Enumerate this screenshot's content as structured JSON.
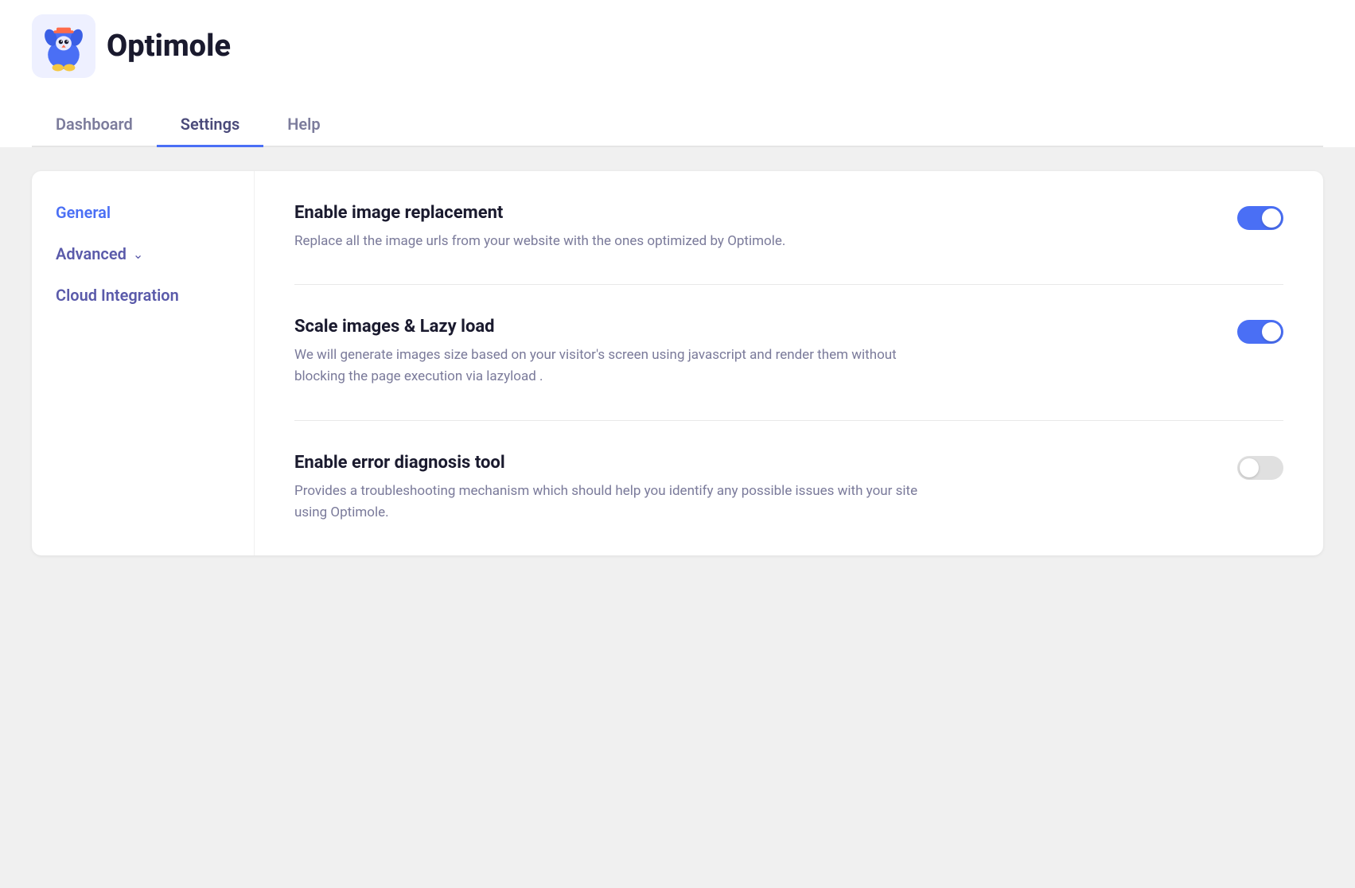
{
  "header": {
    "logo_text": "Optimole",
    "tabs": [
      {
        "id": "dashboard",
        "label": "Dashboard",
        "active": false
      },
      {
        "id": "settings",
        "label": "Settings",
        "active": true
      },
      {
        "id": "help",
        "label": "Help",
        "active": false
      }
    ]
  },
  "sidebar": {
    "items": [
      {
        "id": "general",
        "label": "General",
        "active": true,
        "has_chevron": false
      },
      {
        "id": "advanced",
        "label": "Advanced",
        "active": false,
        "has_chevron": true
      },
      {
        "id": "cloud-integration",
        "label": "Cloud Integration",
        "active": false,
        "has_chevron": false
      }
    ]
  },
  "settings": [
    {
      "id": "image-replacement",
      "title": "Enable image replacement",
      "description": "Replace all the image urls from your website with the ones optimized by Optimole.",
      "enabled": true
    },
    {
      "id": "scale-lazy",
      "title": "Scale images & Lazy load",
      "description": "We will generate images size based on your visitor's screen using javascript and render them without blocking the page execution via lazyload .",
      "enabled": true
    },
    {
      "id": "error-diagnosis",
      "title": "Enable error diagnosis tool",
      "description": "Provides a troubleshooting mechanism which should help you identify any possible issues with your site using Optimole.",
      "enabled": false
    }
  ],
  "colors": {
    "accent": "#4a6ff5",
    "sidebar_active": "#4a6ff5",
    "sidebar_inactive": "#5a5aaa",
    "toggle_on": "#4a6ff5",
    "toggle_off": "#e0e0e0"
  }
}
